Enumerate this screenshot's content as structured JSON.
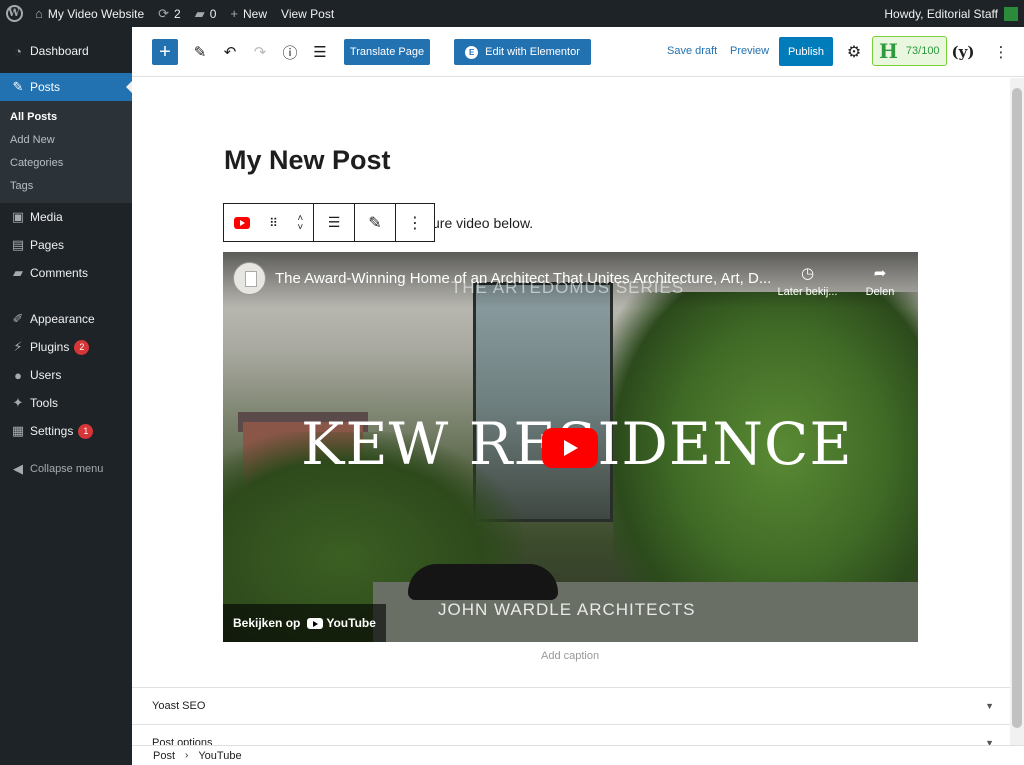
{
  "adminbar": {
    "site_name": "My Video Website",
    "updates_count": "2",
    "comments_count": "0",
    "new_label": "New",
    "view_post_label": "View Post",
    "howdy": "Howdy, Editorial Staff"
  },
  "sidebar": {
    "dashboard": "Dashboard",
    "posts": "Posts",
    "all_posts": "All Posts",
    "add_new": "Add New",
    "categories": "Categories",
    "tags": "Tags",
    "media": "Media",
    "pages": "Pages",
    "comments": "Comments",
    "appearance": "Appearance",
    "plugins": "Plugins",
    "plugins_badge": "2",
    "users": "Users",
    "tools": "Tools",
    "settings": "Settings",
    "settings_badge": "1",
    "collapse": "Collapse menu"
  },
  "toolbar": {
    "translate": "Translate Page",
    "elementor": "Edit with Elementor",
    "elementor_icon": "E",
    "save_draft": "Save draft",
    "preview": "Preview",
    "publish": "Publish",
    "score_letter": "H",
    "score": "73/100"
  },
  "editor": {
    "title": "My New Post",
    "paragraph_visible": "ure video below."
  },
  "video": {
    "title": "The Award-Winning Home of an Architect That Unites Architecture, Art, D...",
    "series_overlay": "THE ARTEDOMUS SERIES",
    "watch_later": "Later bekij...",
    "share": "Delen",
    "big_title": "KEW RESIDENCE",
    "architects": "JOHN WARDLE ARCHITECTS",
    "watch_on": "Bekijken op",
    "youtube": "YouTube"
  },
  "caption_placeholder": "Add caption",
  "meta_boxes": {
    "yoast": "Yoast SEO",
    "post_options": "Post options"
  },
  "breadcrumb": {
    "post": "Post",
    "block": "YouTube"
  }
}
